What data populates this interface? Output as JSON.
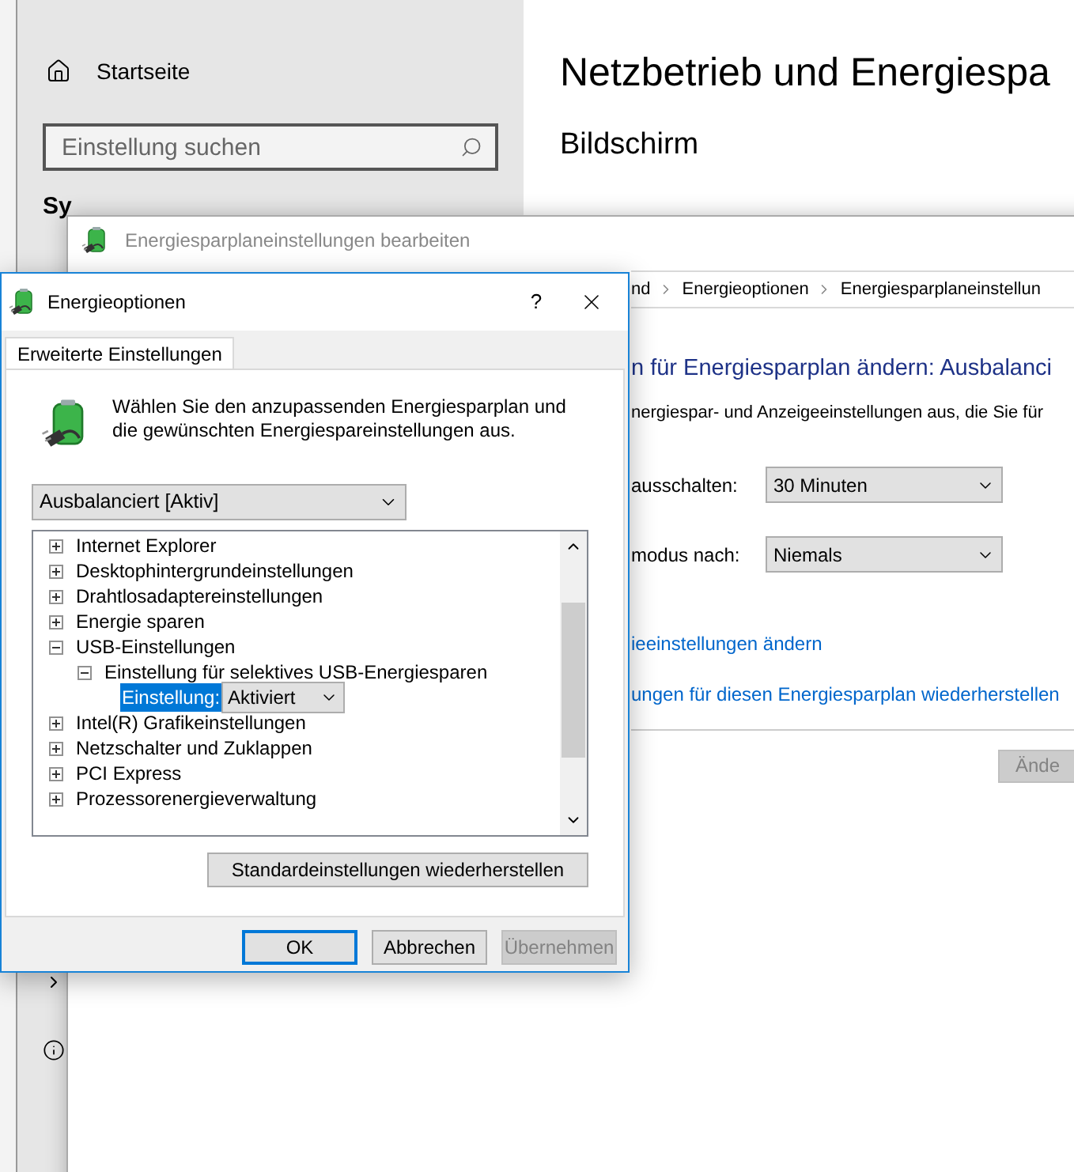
{
  "settings_window": {
    "home": "Startseite",
    "search": {
      "placeholder": "Einstellung suchen"
    },
    "sidebar_heading": "Sy",
    "title": "Netzbetrieb und Energiespa",
    "section": "Bildschirm"
  },
  "control_panel_window": {
    "title": "Energiesparplaneinstellungen bearbeiten",
    "breadcrumb": [
      "nd",
      "Energieoptionen",
      "Energiesparplaneinstellun"
    ],
    "heading": "n für Energiesparplan ändern: Ausbalanci",
    "description": "nergiespar- und Anzeigeeinstellungen aus, die Sie für",
    "settings": [
      {
        "label": "ausschalten:",
        "value": "30 Minuten"
      },
      {
        "label": "modus nach:",
        "value": "Niemals"
      }
    ],
    "links": [
      "ieeinstellungen ändern",
      "ungen für diesen Energiesparplan wiederherstellen"
    ],
    "button": {
      "label": "Ände",
      "disabled": true
    }
  },
  "dialog": {
    "title": "Energieoptionen",
    "help": "?",
    "tabs": [
      {
        "label": "Erweiterte Einstellungen",
        "selected": true
      }
    ],
    "intro": "Wählen Sie den anzupassenden Energiesparplan und die gewünschten Energiespareinstellungen aus.",
    "plan_select": "Ausbalanciert [Aktiv]",
    "tree": [
      {
        "kind": "group",
        "label": "Internet Explorer",
        "expanded": false
      },
      {
        "kind": "group",
        "label": "Desktophintergrundeinstellungen",
        "expanded": false
      },
      {
        "kind": "group",
        "label": "Drahtlosadaptereinstellungen",
        "expanded": false
      },
      {
        "kind": "group",
        "label": "Energie sparen",
        "expanded": false
      },
      {
        "kind": "group",
        "label": "USB-Einstellungen",
        "expanded": true,
        "children": [
          {
            "kind": "group",
            "label": "Einstellung für selektives USB-Energiesparen",
            "expanded": true,
            "children": [
              {
                "kind": "setting",
                "label": "Einstellung:",
                "selected": true,
                "value": "Aktiviert"
              }
            ]
          }
        ]
      },
      {
        "kind": "group",
        "label": "Intel(R) Grafikeinstellungen",
        "expanded": false
      },
      {
        "kind": "group",
        "label": "Netzschalter und Zuklappen",
        "expanded": false
      },
      {
        "kind": "group",
        "label": "PCI Express",
        "expanded": false
      },
      {
        "kind": "group",
        "label": "Prozessorenergieverwaltung",
        "expanded": false
      }
    ],
    "restore_button": "Standardeinstellungen wiederherstellen",
    "buttons": [
      {
        "label": "OK",
        "default": true,
        "disabled": false
      },
      {
        "label": "Abbrechen",
        "default": false,
        "disabled": false
      },
      {
        "label": "Übernehmen",
        "default": false,
        "disabled": true
      }
    ]
  }
}
